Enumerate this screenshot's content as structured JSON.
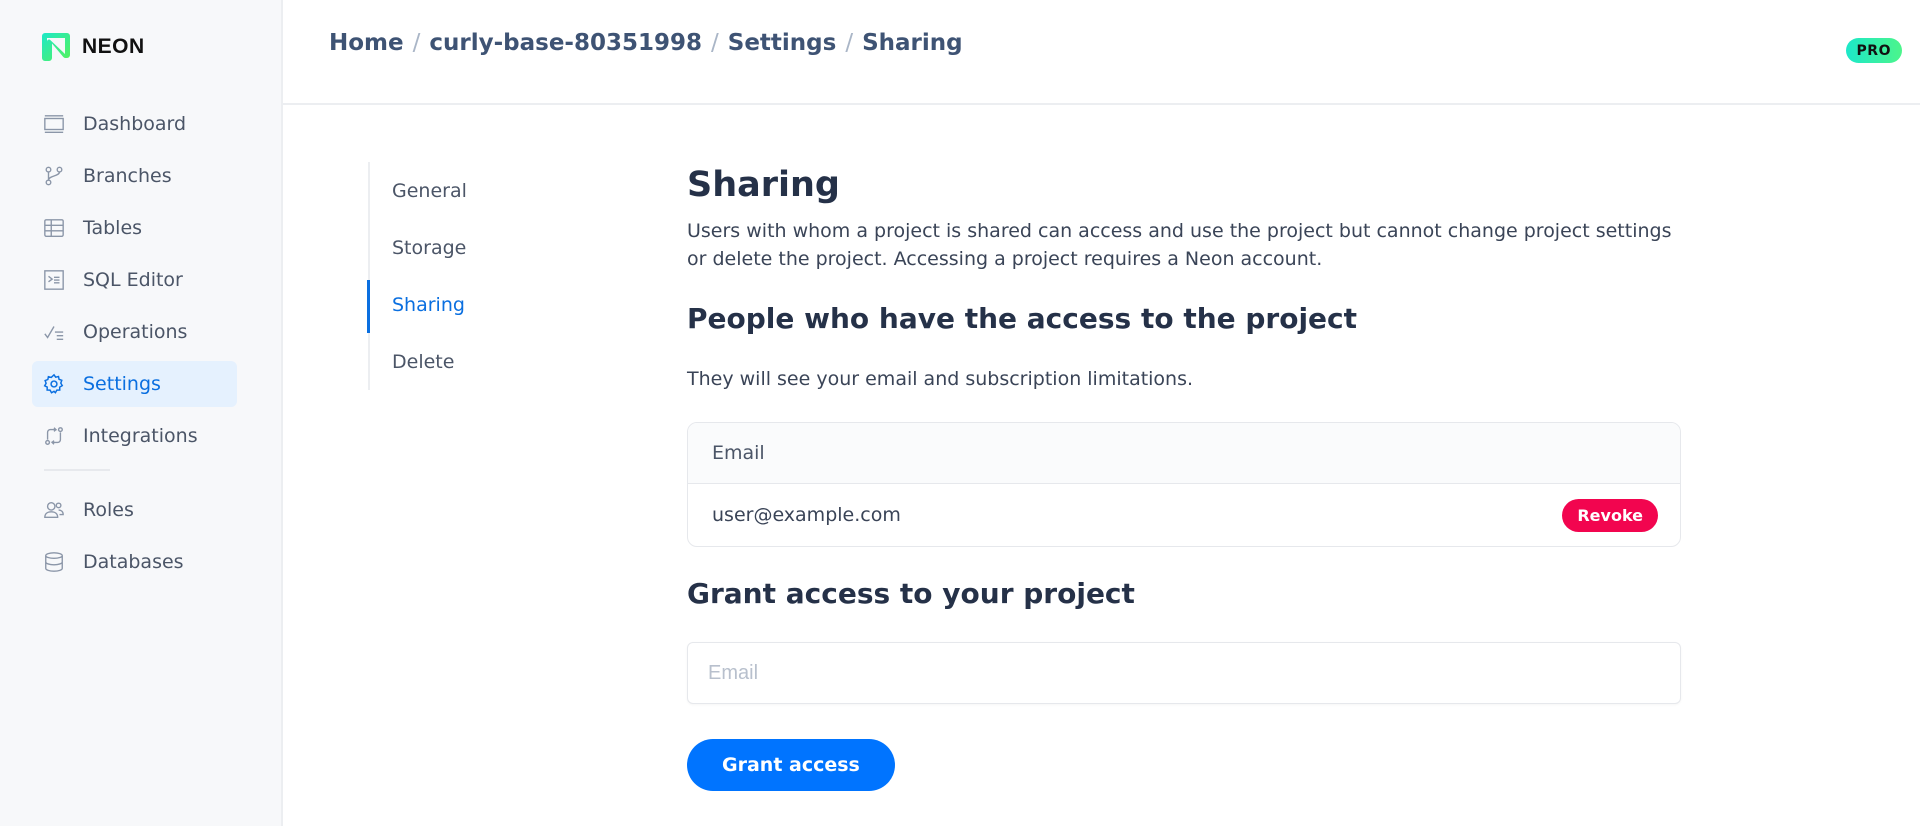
{
  "brand": {
    "name": "NEON",
    "logo_icon": "neon-logo-icon"
  },
  "sidebar": {
    "items": [
      {
        "label": "Dashboard",
        "icon": "dashboard-icon",
        "active": false
      },
      {
        "label": "Branches",
        "icon": "branches-icon",
        "active": false
      },
      {
        "label": "Tables",
        "icon": "tables-icon",
        "active": false
      },
      {
        "label": "SQL Editor",
        "icon": "sql-editor-icon",
        "active": false
      },
      {
        "label": "Operations",
        "icon": "operations-icon",
        "active": false
      },
      {
        "label": "Settings",
        "icon": "gear-icon",
        "active": true
      },
      {
        "label": "Integrations",
        "icon": "integrations-icon",
        "active": false
      }
    ],
    "secondary_items": [
      {
        "label": "Roles",
        "icon": "users-icon",
        "active": false
      },
      {
        "label": "Databases",
        "icon": "database-icon",
        "active": false
      }
    ]
  },
  "header": {
    "breadcrumb": [
      "Home",
      "curly-base-80351998",
      "Settings",
      "Sharing"
    ],
    "separator": "/",
    "plan_badge": "PRO"
  },
  "settings_nav": {
    "items": [
      {
        "label": "General",
        "active": false
      },
      {
        "label": "Storage",
        "active": false
      },
      {
        "label": "Sharing",
        "active": true
      },
      {
        "label": "Delete",
        "active": false
      }
    ]
  },
  "content": {
    "title": "Sharing",
    "description": "Users with whom a project is shared can access and use the project but cannot change project settings or delete the project. Accessing a project requires a Neon account.",
    "people_section": {
      "title": "People who have the access to the project",
      "subtitle": "They will see your email and subscription limitations.",
      "table": {
        "columns": [
          "Email"
        ],
        "rows": [
          {
            "email": "user@example.com",
            "action_label": "Revoke"
          }
        ]
      }
    },
    "grant_section": {
      "title": "Grant access to your project",
      "email_input": {
        "value": "",
        "placeholder": "Email"
      },
      "button_label": "Grant access"
    }
  },
  "colors": {
    "accent": "#0a6fe0",
    "primary_button": "#0074ff",
    "danger": "#f2054f",
    "pro_badge_gradient": [
      "#1ce8c9",
      "#4cf58b"
    ]
  }
}
